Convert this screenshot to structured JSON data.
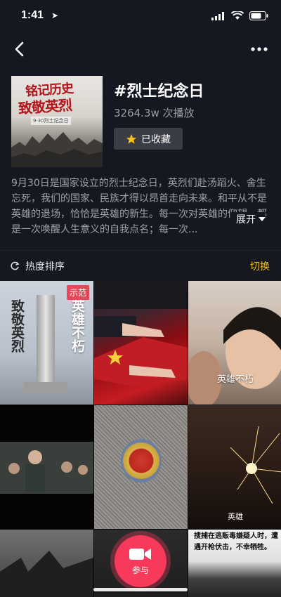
{
  "status_bar": {
    "time": "1:41"
  },
  "header": {
    "title": "#烈士纪念日",
    "play_count": "3264.3w 次播放",
    "favorite_label": "已收藏",
    "cover": {
      "line1": "铭记历史",
      "line2": "致敬英烈",
      "subtitle": "9·30烈士纪念日"
    }
  },
  "description": {
    "text": "9月30日是国家设立的烈士纪念日，英烈们赴汤蹈火、舍生忘死，我们的国家、民族才得以昂首走向未来。和平从不是英雄的退场，恰恰是英雄的新生。每一次对英雄的仰望，都是一次唤醒人生意义的自我点名；每一次...",
    "expand_label": "展开"
  },
  "sort_bar": {
    "label": "热度排序",
    "switch_label": "切换"
  },
  "grid": {
    "tile1": {
      "badge": "示范",
      "left_text": "致敬英烈",
      "right_text": "英雄不朽"
    },
    "tile3": {
      "caption": "英雄不朽"
    },
    "tile6": {
      "caption": "英雄"
    },
    "tile9": {
      "caption": "搜捕在逃贩毒嫌疑人时，遭遇开枪伏击，不幸牺牲。"
    }
  },
  "record_button": {
    "label": "参与"
  },
  "colors": {
    "accent_yellow": "#f7c11b",
    "record_red": "#f7395c",
    "background": "#151821"
  }
}
